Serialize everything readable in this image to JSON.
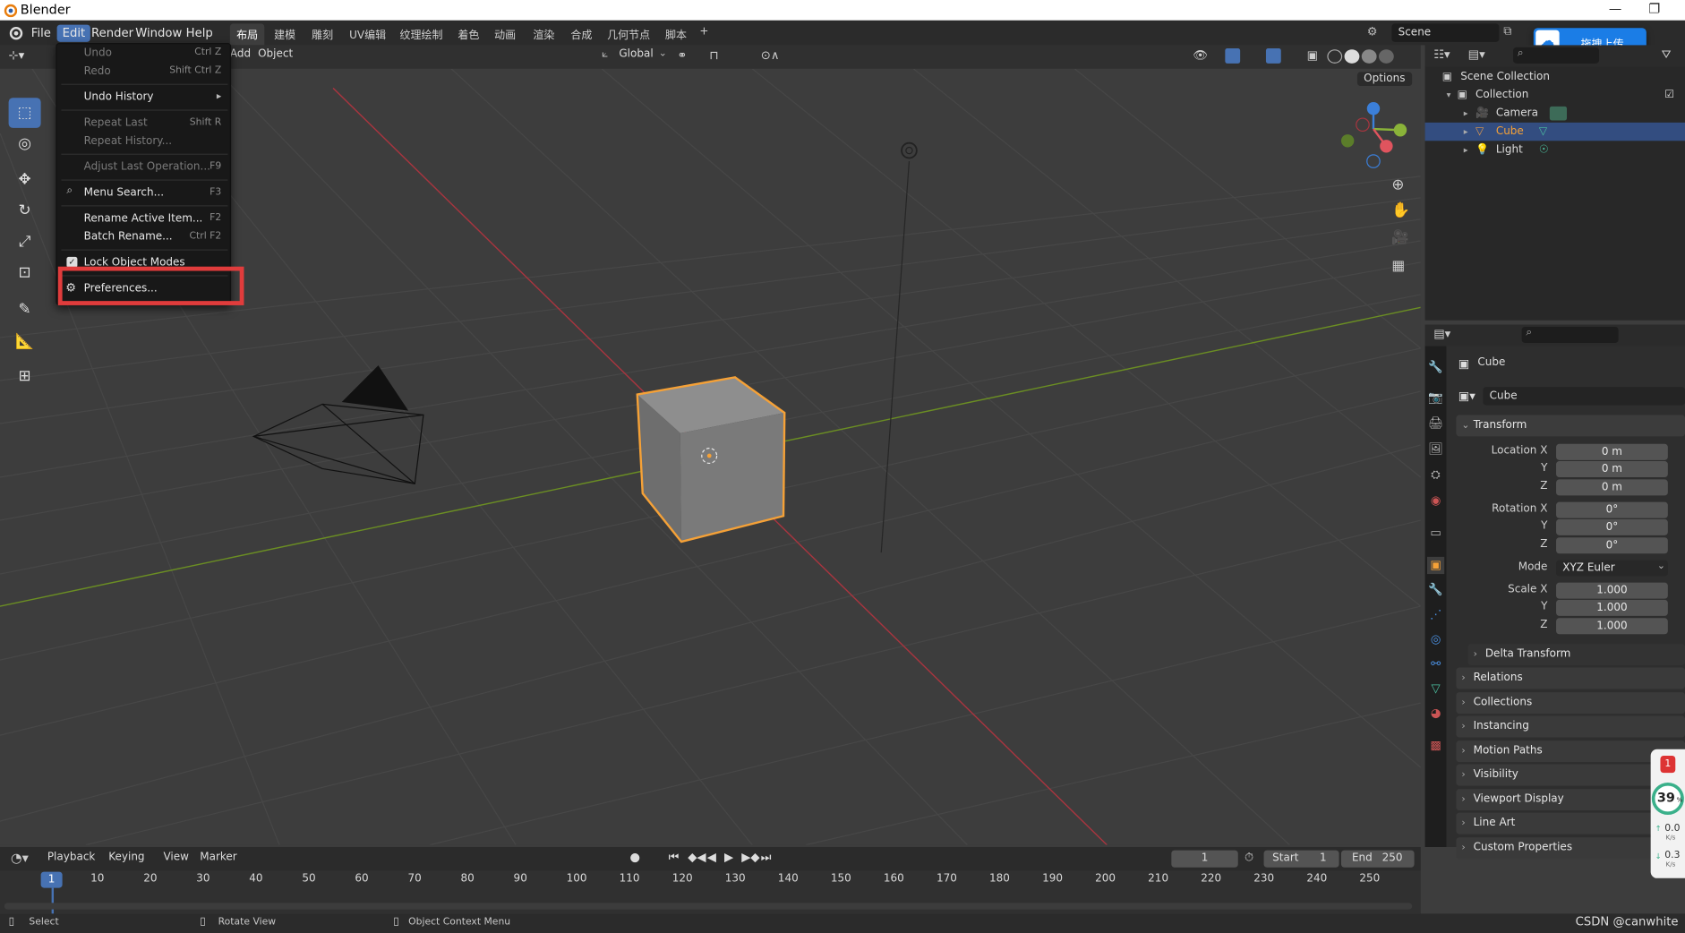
{
  "app": {
    "title": "Blender"
  },
  "menu": {
    "file": "File",
    "edit": "Edit",
    "render": "Render",
    "window": "Window",
    "help": "Help"
  },
  "workspaces": [
    "布局",
    "建模",
    "雕刻",
    "UV编辑",
    "纹理绘制",
    "着色",
    "动画",
    "渲染",
    "合成",
    "几何节点",
    "脚本",
    "+"
  ],
  "scene": {
    "label": "Scene"
  },
  "upload": {
    "label": "拖拽上传"
  },
  "viewport_header": {
    "add": "Add",
    "object": "Object",
    "transform": "Global",
    "options": "Options"
  },
  "edit_menu": {
    "undo": {
      "label": "Undo",
      "shortcut": "Ctrl Z"
    },
    "redo": {
      "label": "Redo",
      "shortcut": "Shift Ctrl Z"
    },
    "undo_history": "Undo History",
    "repeat_last": {
      "label": "Repeat Last",
      "shortcut": "Shift R"
    },
    "repeat_history": "Repeat History...",
    "adjust_last": {
      "label": "Adjust Last Operation...",
      "shortcut": "F9"
    },
    "menu_search": {
      "label": "Menu Search...",
      "shortcut": "F3"
    },
    "rename_active": {
      "label": "Rename Active Item...",
      "shortcut": "F2"
    },
    "batch_rename": {
      "label": "Batch Rename...",
      "shortcut": "Ctrl F2"
    },
    "lock_modes": "Lock Object Modes",
    "preferences": "Preferences..."
  },
  "outliner": {
    "scene_collection": "Scene Collection",
    "collection": "Collection",
    "camera": "Camera",
    "cube": "Cube",
    "light": "Light"
  },
  "properties": {
    "object_name": "Cube",
    "data_name": "Cube",
    "transform": "Transform",
    "location_x_label": "Location X",
    "location_x": "0 m",
    "y_label": "Y",
    "location_y": "0 m",
    "z_label": "Z",
    "location_z": "0 m",
    "rotation_x_label": "Rotation X",
    "rotation_x": "0°",
    "rotation_y": "0°",
    "rotation_z": "0°",
    "mode_label": "Mode",
    "mode": "XYZ Euler",
    "scale_x_label": "Scale X",
    "scale_x": "1.000",
    "scale_y": "1.000",
    "scale_z": "1.000",
    "delta_transform": "Delta Transform",
    "relations": "Relations",
    "collections": "Collections",
    "instancing": "Instancing",
    "motion_paths": "Motion Paths",
    "visibility": "Visibility",
    "viewport_display": "Viewport Display",
    "line_art": "Line Art",
    "custom_properties": "Custom Properties"
  },
  "widget": {
    "percent": "39",
    "unit": "%",
    "up": "0.0",
    "up_unit": "K/s",
    "down": "0.3",
    "down_unit": "K/s",
    "badge": "1"
  },
  "timeline": {
    "playback": "Playback",
    "keying": "Keying",
    "view": "View",
    "marker": "Marker",
    "current_frame": "1",
    "start_label": "Start",
    "start": "1",
    "end_label": "End",
    "end": "250",
    "ticks": [
      "1",
      "10",
      "20",
      "30",
      "40",
      "50",
      "60",
      "70",
      "80",
      "90",
      "100",
      "110",
      "120",
      "130",
      "140",
      "150",
      "160",
      "170",
      "180",
      "190",
      "200",
      "210",
      "220",
      "230",
      "240",
      "250"
    ]
  },
  "status": {
    "select": "Select",
    "rotate_view": "Rotate View",
    "context_menu": "Object Context Menu",
    "watermark": "CSDN @canwhite"
  },
  "colors": {
    "accent": "#4772b3",
    "highlight_box": "#e03c3c",
    "selected_orange": "#f5a137",
    "x_axis": "#e0545e",
    "y_axis": "#8ab339",
    "z_axis": "#3b7fd9"
  }
}
